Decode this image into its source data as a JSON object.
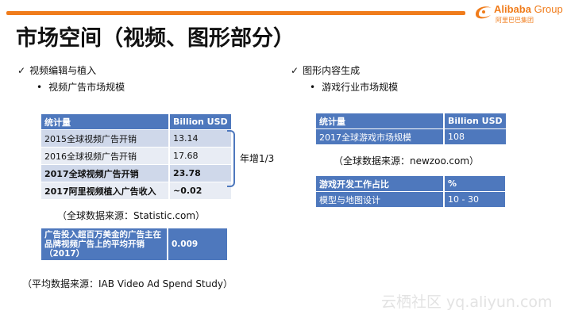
{
  "header": {
    "logo_text": "Alibaba",
    "logo_group": "Group",
    "logo_sub": "阿里巴巴集团",
    "title": "市场空间（视频、图形部分）",
    "accent_color": "#f07c1b"
  },
  "left": {
    "heading": "视频编辑与植入",
    "subheading": "视频广告市场规模",
    "table": {
      "headers": [
        "统计量",
        "Billion USD"
      ],
      "rows": [
        {
          "label": "2015全球视频广告开销",
          "value": "13.14"
        },
        {
          "label": "2016全球视频广告开销",
          "value": "17.68"
        },
        {
          "label": "2017全球视频广告开销",
          "value": "23.78"
        },
        {
          "label": "2017阿里视频植入广告收入",
          "value": "~0.02"
        }
      ]
    },
    "bracket_note": "年增1/3",
    "source1": "（全球数据来源：Statistic.com）",
    "avg": {
      "label": "广告投入超百万美金的广告主在品牌视频广告上的平均开销（2017）",
      "value": "0.009"
    },
    "source2": "（平均数据来源：IAB Video Ad Spend Study）"
  },
  "right": {
    "heading": "图形内容生成",
    "subheading": "游戏行业市场规模",
    "table1": {
      "headers": [
        "统计量",
        "Billion USD"
      ],
      "rows": [
        {
          "label": "2017全球游戏市场规模",
          "value": "108"
        }
      ]
    },
    "source": "（全球数据来源：newzoo.com）",
    "table2": {
      "headers": [
        "游戏开发工作占比",
        "%"
      ],
      "rows": [
        {
          "label": "模型与地图设计",
          "value": "10 - 30"
        }
      ]
    }
  },
  "watermark": "云栖社区 yq.aliyun.com",
  "colors": {
    "table_header": "#4e78bd",
    "row_dark": "#cfd8ea",
    "row_light": "#e8ecf4"
  }
}
